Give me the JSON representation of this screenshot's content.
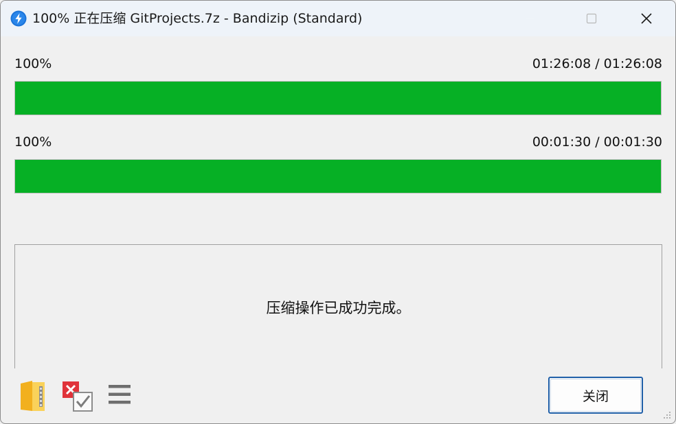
{
  "titlebar": {
    "title": "100% 正在压缩 GitProjects.7z - Bandizip (Standard)",
    "app_icon": "bandizip-logo-icon",
    "minimize_icon": "minimize-icon",
    "maximize_icon": "maximize-icon",
    "close_icon": "close-icon"
  },
  "progress": [
    {
      "percent_text": "100%",
      "time_text": "01:26:08 / 01:26:08",
      "fraction": 1.0
    },
    {
      "percent_text": "100%",
      "time_text": "00:01:30 / 00:01:30",
      "fraction": 1.0
    }
  ],
  "message": {
    "text": "压缩操作已成功完成。"
  },
  "footer": {
    "open_folder_icon": "open-archive-folder-icon",
    "auto_close_icon": "close-when-done-checkbox-icon",
    "menu_icon": "menu-icon",
    "close_button_label": "关闭"
  },
  "colors": {
    "progress_fill": "#06b025",
    "titlebar_bg": "#eef3f9",
    "window_bg": "#f0f0f0",
    "button_border": "#1f5fa8"
  }
}
